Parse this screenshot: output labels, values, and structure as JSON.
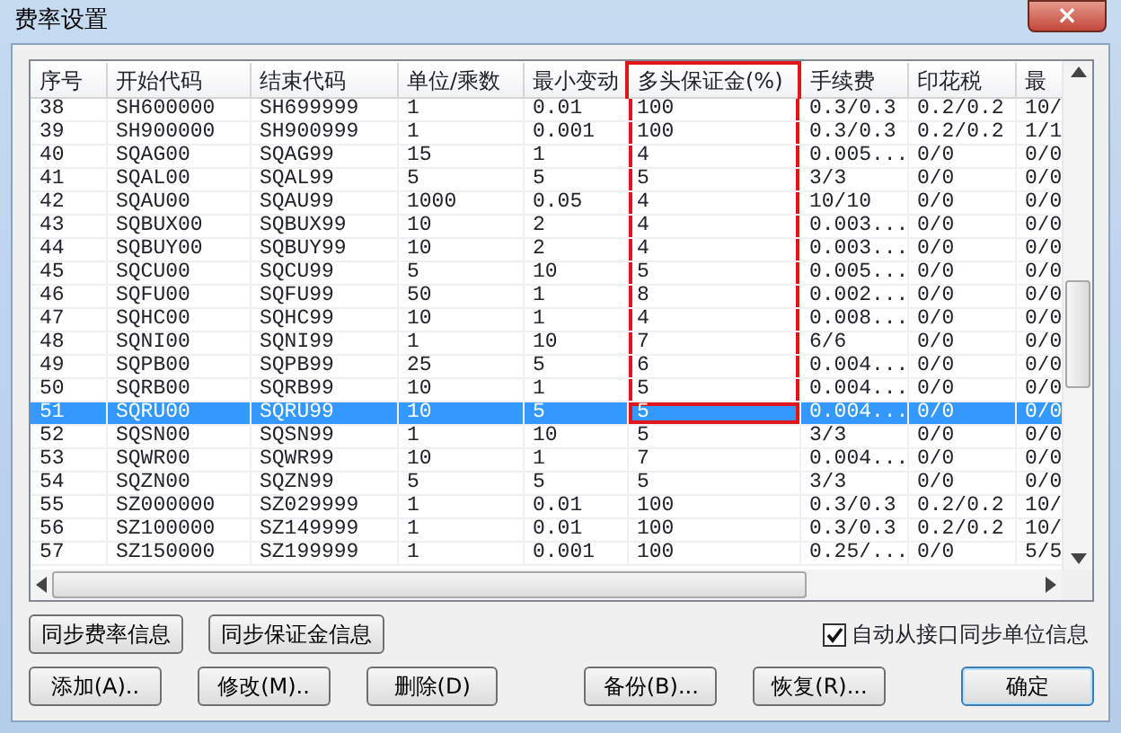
{
  "window": {
    "title": "费率设置",
    "close": "×"
  },
  "table": {
    "columns": [
      {
        "label": "序号",
        "highlighted": false
      },
      {
        "label": "开始代码",
        "highlighted": false
      },
      {
        "label": "结束代码",
        "highlighted": false
      },
      {
        "label": "单位/乘数",
        "highlighted": false
      },
      {
        "label": "最小变动",
        "highlighted": false
      },
      {
        "label": "多头保证金(%)",
        "highlighted": true
      },
      {
        "label": "手续费",
        "highlighted": false
      },
      {
        "label": "印花税",
        "highlighted": false
      },
      {
        "label": "最",
        "highlighted": false
      }
    ],
    "rows": [
      {
        "cells": [
          "38",
          "SH600000",
          "SH699999",
          "1",
          "0.01",
          "100",
          "0.3/0.3",
          "0.2/0.2",
          "10/"
        ],
        "selected": false,
        "highlighted": true
      },
      {
        "cells": [
          "39",
          "SH900000",
          "SH900999",
          "1",
          "0.001",
          "100",
          "0.3/0.3",
          "0.2/0.2",
          "1/1"
        ],
        "selected": false,
        "highlighted": true
      },
      {
        "cells": [
          "40",
          "SQAG00",
          "SQAG99",
          "15",
          "1",
          "4",
          "0.005...",
          "0/0",
          "0/0"
        ],
        "selected": false,
        "highlighted": true
      },
      {
        "cells": [
          "41",
          "SQAL00",
          "SQAL99",
          "5",
          "5",
          "5",
          "3/3",
          "0/0",
          "0/0"
        ],
        "selected": false,
        "highlighted": true
      },
      {
        "cells": [
          "42",
          "SQAU00",
          "SQAU99",
          "1000",
          "0.05",
          "4",
          "10/10",
          "0/0",
          "0/0"
        ],
        "selected": false,
        "highlighted": true
      },
      {
        "cells": [
          "43",
          "SQBUX00",
          "SQBUX99",
          "10",
          "2",
          "4",
          "0.003...",
          "0/0",
          "0/0"
        ],
        "selected": false,
        "highlighted": true
      },
      {
        "cells": [
          "44",
          "SQBUY00",
          "SQBUY99",
          "10",
          "2",
          "4",
          "0.003...",
          "0/0",
          "0/0"
        ],
        "selected": false,
        "highlighted": true
      },
      {
        "cells": [
          "45",
          "SQCU00",
          "SQCU99",
          "5",
          "10",
          "5",
          "0.005...",
          "0/0",
          "0/0"
        ],
        "selected": false,
        "highlighted": true
      },
      {
        "cells": [
          "46",
          "SQFU00",
          "SQFU99",
          "50",
          "1",
          "8",
          "0.002...",
          "0/0",
          "0/0"
        ],
        "selected": false,
        "highlighted": true
      },
      {
        "cells": [
          "47",
          "SQHC00",
          "SQHC99",
          "10",
          "1",
          "4",
          "0.008...",
          "0/0",
          "0/0"
        ],
        "selected": false,
        "highlighted": true
      },
      {
        "cells": [
          "48",
          "SQNI00",
          "SQNI99",
          "1",
          "10",
          "7",
          "6/6",
          "0/0",
          "0/0"
        ],
        "selected": false,
        "highlighted": true
      },
      {
        "cells": [
          "49",
          "SQPB00",
          "SQPB99",
          "25",
          "5",
          "6",
          "0.004...",
          "0/0",
          "0/0"
        ],
        "selected": false,
        "highlighted": true
      },
      {
        "cells": [
          "50",
          "SQRB00",
          "SQRB99",
          "10",
          "1",
          "5",
          "0.004...",
          "0/0",
          "0/0"
        ],
        "selected": false,
        "highlighted": true
      },
      {
        "cells": [
          "51",
          "SQRU00",
          "SQRU99",
          "10",
          "5",
          "5",
          "0.004...",
          "0/0",
          "0/0"
        ],
        "selected": true,
        "highlighted": true
      },
      {
        "cells": [
          "52",
          "SQSN00",
          "SQSN99",
          "1",
          "10",
          "5",
          "3/3",
          "0/0",
          "0/0"
        ],
        "selected": false,
        "highlighted": false
      },
      {
        "cells": [
          "53",
          "SQWR00",
          "SQWR99",
          "10",
          "1",
          "7",
          "0.004...",
          "0/0",
          "0/0"
        ],
        "selected": false,
        "highlighted": false
      },
      {
        "cells": [
          "54",
          "SQZN00",
          "SQZN99",
          "5",
          "5",
          "5",
          "3/3",
          "0/0",
          "0/0"
        ],
        "selected": false,
        "highlighted": false
      },
      {
        "cells": [
          "55",
          "SZ000000",
          "SZ029999",
          "1",
          "0.01",
          "100",
          "0.3/0.3",
          "0.2/0.2",
          "10/"
        ],
        "selected": false,
        "highlighted": false
      },
      {
        "cells": [
          "56",
          "SZ100000",
          "SZ149999",
          "1",
          "0.01",
          "100",
          "0.3/0.3",
          "0.2/0.2",
          "10/"
        ],
        "selected": false,
        "highlighted": false
      },
      {
        "cells": [
          "57",
          "SZ150000",
          "SZ199999",
          "1",
          "0.001",
          "100",
          "0.25/...",
          "0/0",
          "5/5"
        ],
        "selected": false,
        "highlighted": false
      }
    ]
  },
  "sync_buttons": [
    "同步费率信息",
    "同步保证金信息"
  ],
  "auto_sync": {
    "label": "自动从接口同步单位信息",
    "checked": true
  },
  "action_buttons": [
    {
      "label": "添加(A)..",
      "kind": "normal"
    },
    {
      "label": "修改(M)..",
      "kind": "normal"
    },
    {
      "label": "删除(D)",
      "kind": "normal"
    },
    {
      "label": "备份(B)...",
      "kind": "normal"
    },
    {
      "label": "恢复(R)...",
      "kind": "normal"
    },
    {
      "label": "确定",
      "kind": "default"
    }
  ]
}
